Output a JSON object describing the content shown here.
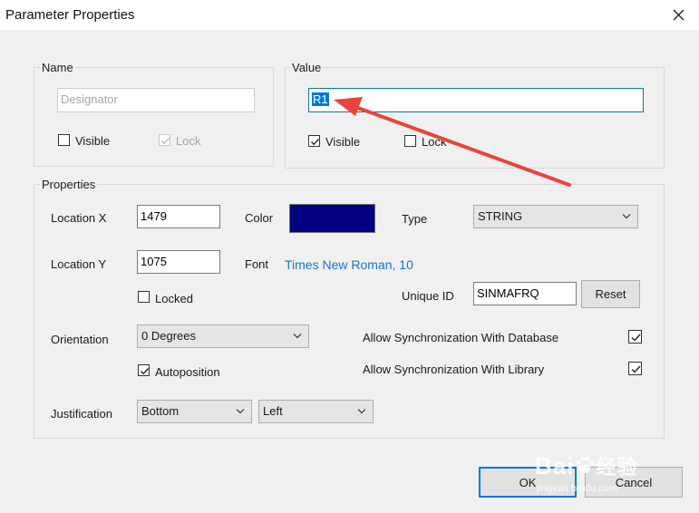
{
  "window": {
    "title": "Parameter Properties"
  },
  "name_group": {
    "legend": "Name",
    "value": "Designator",
    "visible_label": "Visible",
    "visible_checked": false,
    "lock_label": "Lock",
    "lock_checked": true
  },
  "value_group": {
    "legend": "Value",
    "value": "R1",
    "visible_label": "Visible",
    "visible_checked": true,
    "lock_label": "Lock",
    "lock_checked": false
  },
  "properties": {
    "legend": "Properties",
    "location_x_label": "Location  X",
    "location_x": "1479",
    "location_y_label": "Location  Y",
    "location_y": "1075",
    "locked_label": "Locked",
    "color_label": "Color",
    "color_value": "#000080",
    "font_label": "Font",
    "font_value": "Times New Roman, 10",
    "type_label": "Type",
    "type_value": "STRING",
    "unique_id_label": "Unique ID",
    "unique_id": "SINMAFRQ",
    "reset_label": "Reset",
    "orientation_label": "Orientation",
    "orientation_value": "0 Degrees",
    "autoposition_label": "Autoposition",
    "autoposition_checked": true,
    "sync_db_label": "Allow Synchronization With Database",
    "sync_db_checked": true,
    "sync_lib_label": "Allow Synchronization With Library",
    "sync_lib_checked": true,
    "justification_label": "Justification",
    "justification_vertical": "Bottom",
    "justification_horizontal": "Left"
  },
  "buttons": {
    "ok": "OK",
    "cancel": "Cancel"
  },
  "watermark": {
    "brand": "Bai",
    "brand_suffix": "经验",
    "url": "jingyan.baidu.com"
  },
  "colors": {
    "annotation_arrow": "#e8453c",
    "accent": "#0078d7",
    "link": "#1a73c7"
  }
}
